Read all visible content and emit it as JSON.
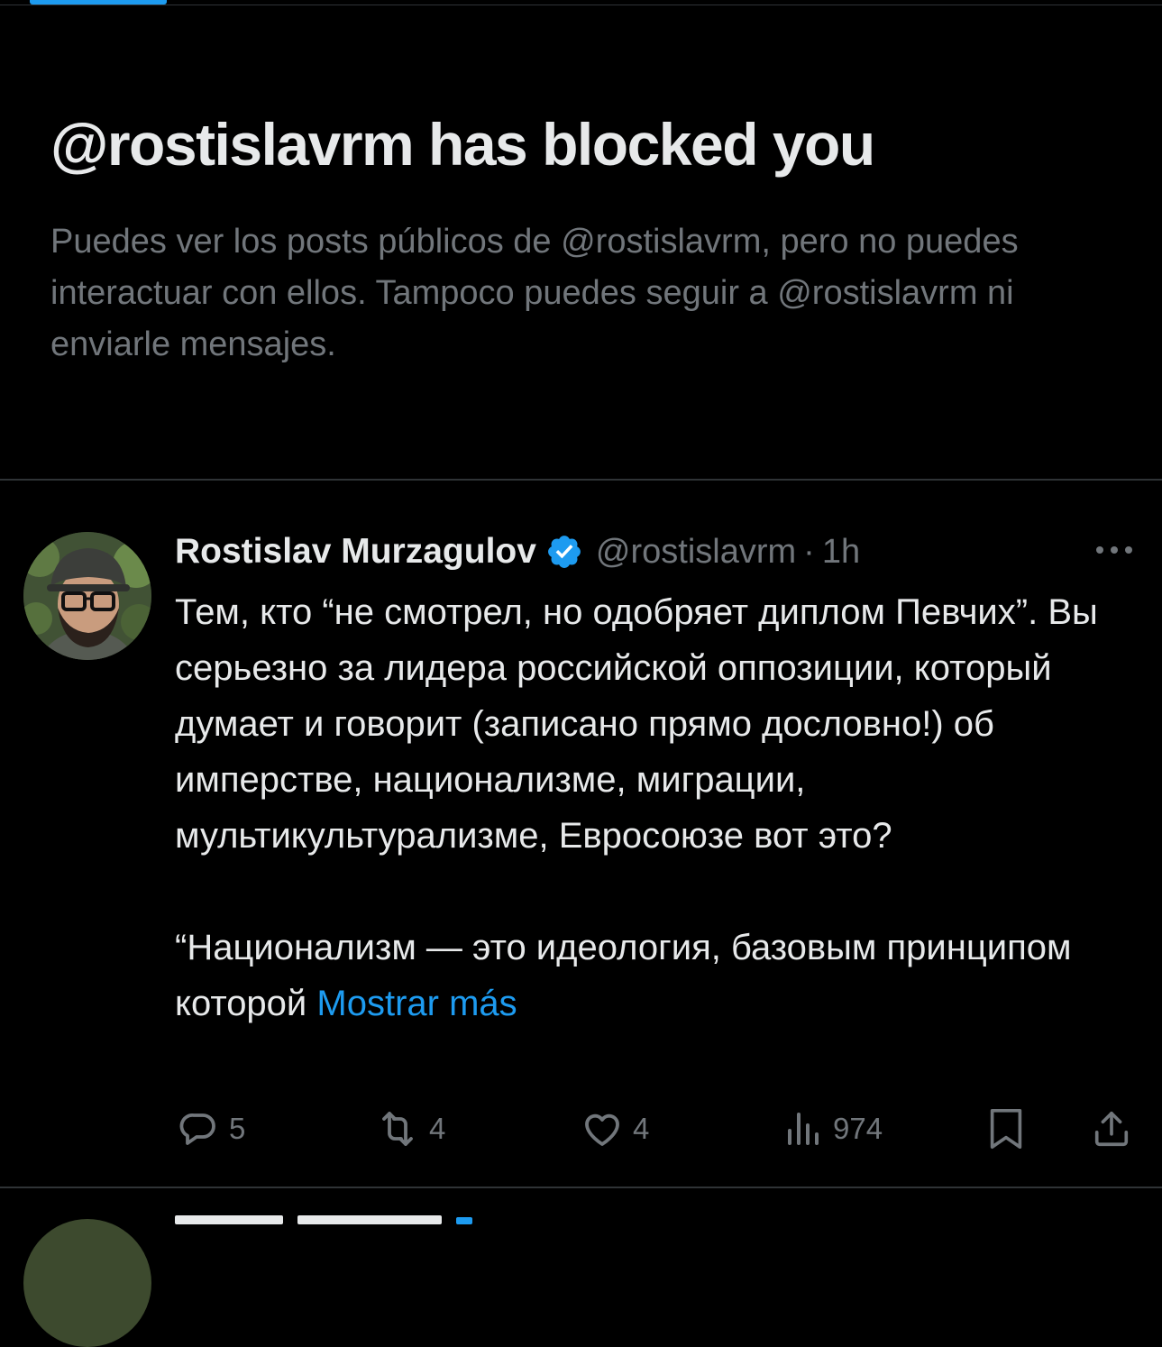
{
  "profile_block": {
    "title": "@rostislavrm has blocked you",
    "description": "Puedes ver los posts públicos de @rostislavrm, pero no puedes interactuar con ellos. Tampoco puedes seguir a @rostislavrm ni enviarle mensajes."
  },
  "tweet": {
    "author_name": "Rostislav Murzagulov",
    "handle": "@rostislavrm",
    "separator": "·",
    "time": "1h",
    "paragraph_1": "Тем, кто “не смотрел, но одобряет диплом Певчих”. Вы серьезно за лидера российской оппозиции, который думает и говорит (записано прямо дословно!) об имперстве, национализме, миграции, мультикультурализме, Евросоюзе вот это?",
    "paragraph_2": "“Национализм — это идеология, базовым принципом которой",
    "show_more": "Mostrar más",
    "replies": "5",
    "reposts": "4",
    "likes": "4",
    "views": "974"
  },
  "icons": {
    "verified": "verified-badge-icon",
    "more": "more-options-icon",
    "reply": "reply-icon",
    "repost": "repost-icon",
    "like": "heart-icon",
    "views": "views-icon",
    "bookmark": "bookmark-icon",
    "share": "share-icon"
  },
  "colors": {
    "background": "#000000",
    "text_primary": "#e7e9ea",
    "text_secondary": "#71767b",
    "accent": "#1d9bf0",
    "divider": "#2f3336"
  }
}
